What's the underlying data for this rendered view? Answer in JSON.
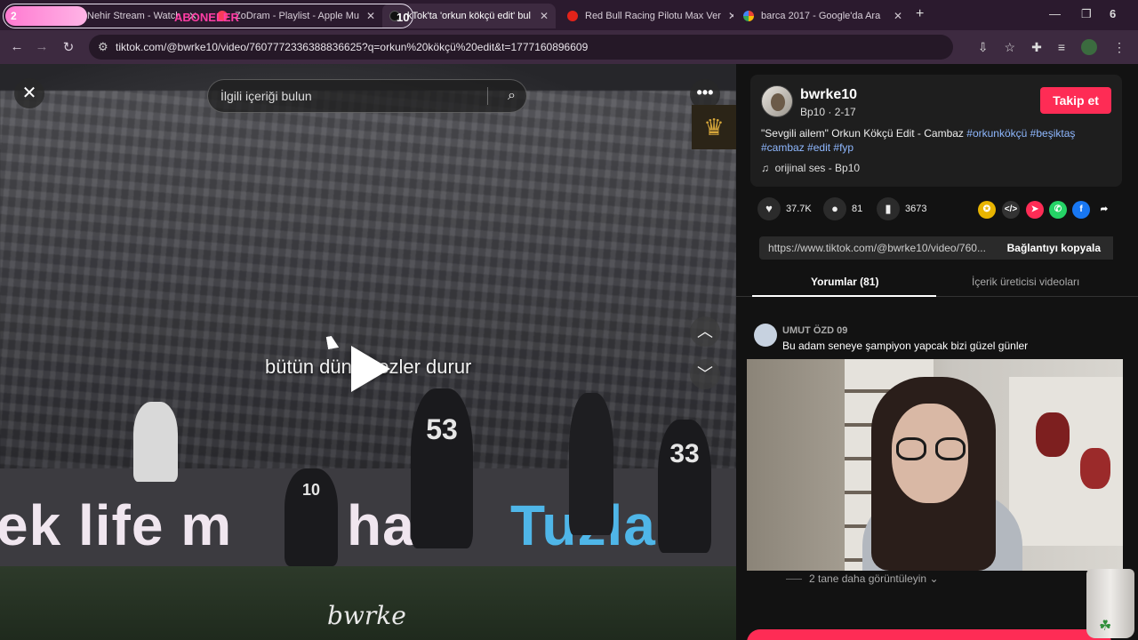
{
  "browser": {
    "tabs": [
      {
        "label": "Nehir Stream - Watch",
        "active": false
      },
      {
        "label": "ZoDram - Playlist - Apple Mu",
        "active": false
      },
      {
        "label": "kTok'ta 'orkun kökçü edit' bul",
        "active": true
      },
      {
        "label": "Red Bull Racing Pilotu Max Ver",
        "active": false
      },
      {
        "label": "barca 2017 - Google'da Ara",
        "active": false
      }
    ],
    "tab_group_badge": "2",
    "overlay_left": "ABONELER",
    "overlay_num": "10",
    "window_count": "6",
    "url": "tiktok.com/@bwrke10/video/7607772336388836625?q=orkun%20kökçü%20edit&t=1777160896609"
  },
  "video": {
    "search_placeholder": "İlgili içeriği bulun",
    "lyric": "bütün dünya ezler durur",
    "board_left": "ek life m",
    "board_mid": "hall",
    "board_right": "Tuzla",
    "jersey_a": "53",
    "jersey_b": "33",
    "jersey_c": "10",
    "watermark": "bwrke"
  },
  "post": {
    "username": "bwrke10",
    "subline": "Bp10 · 2-17",
    "follow_label": "Takip et",
    "desc_text": "\"Sevgili ailem\" Orkun Kökçü Edit - Cambaz ",
    "tag1": "#orkunkökçü",
    "tag2": "#beşiktaş",
    "tag3": "#cambaz",
    "tag4": "#edit",
    "tag5": "#fyp",
    "music": "orijinal ses - Bp10",
    "likes": "37.7K",
    "comments": "81",
    "saves": "3673",
    "link": "https://www.tiktok.com/@bwrke10/video/760...",
    "copy_label": "Bağlantıyı kopyala",
    "tab_comments": "Yorumlar (81)",
    "tab_creator": "İçerik üreticisi videoları"
  },
  "comment": {
    "user": "UMUT ÖZD 09",
    "text": "Bu adam seneye şampiyon yapcak bizi güzel günler"
  },
  "more_replies": "2 tane daha görüntüleyin",
  "colors": {
    "accent": "#fe2c55",
    "hashtag": "#8fb8ff",
    "browser_bg": "#3d2a40"
  }
}
